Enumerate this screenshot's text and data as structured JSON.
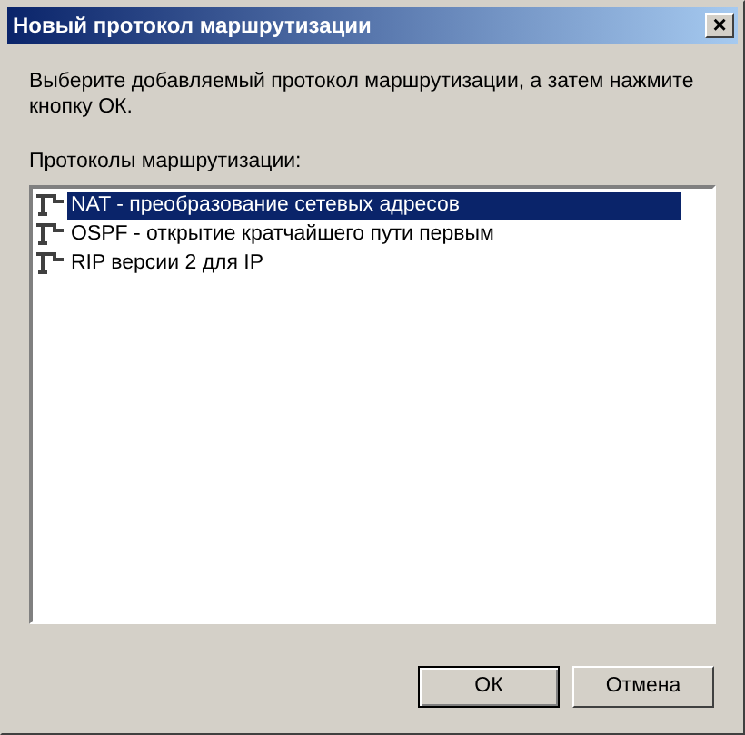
{
  "window": {
    "title": "Новый протокол маршрутизации",
    "close_button": "×"
  },
  "instruction": "Выберите добавляемый протокол маршрутизации, а затем нажмите кнопку ОК.",
  "list_label": "Протоколы маршрутизации:",
  "protocols": [
    {
      "label": "NAT - преобразование сетевых адресов",
      "selected": true
    },
    {
      "label": "OSPF - открытие кратчайшего пути первым",
      "selected": false
    },
    {
      "label": "RIP версии 2 для IP",
      "selected": false
    }
  ],
  "buttons": [
    {
      "label": "ОК",
      "default": true
    },
    {
      "label": "Отмена",
      "default": false
    }
  ]
}
